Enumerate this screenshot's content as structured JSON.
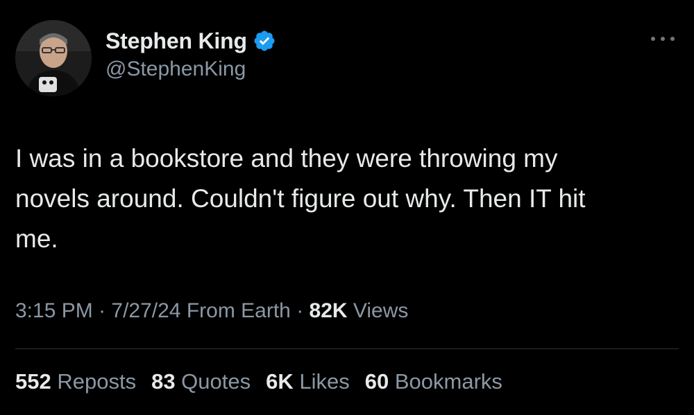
{
  "author": {
    "display_name": "Stephen King",
    "handle": "@StephenKing",
    "verified": true,
    "avatar_icon": "author-avatar"
  },
  "menu_icon": "more-options-icon",
  "tweet": {
    "text": "I was in a bookstore and they were throwing my\nnovels around. Couldn't figure out why. Then IT hit\nme."
  },
  "meta": {
    "time": "3:15 PM",
    "separator": " · ",
    "date": "7/27/24",
    "source": " From Earth",
    "views_count": "82K",
    "views_label": " Views"
  },
  "stats": {
    "reposts_count": "552",
    "reposts_label": " Reposts",
    "quotes_count": "83",
    "quotes_label": " Quotes",
    "likes_count": "6K",
    "likes_label": " Likes",
    "bookmarks_count": "60",
    "bookmarks_label": " Bookmarks"
  },
  "colors": {
    "background": "#000000",
    "primary_text": "#e7e9ea",
    "secondary_text": "#8b98a5",
    "verified_badge": "#1d9bf0",
    "divider": "#2f3336"
  }
}
